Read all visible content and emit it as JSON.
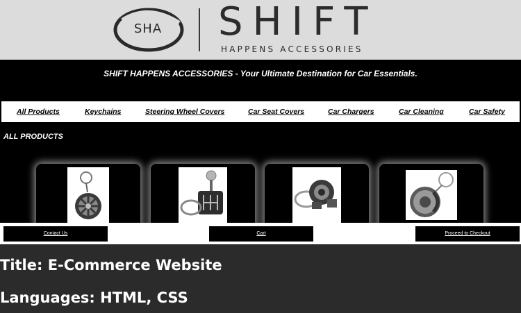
{
  "logo": {
    "initials": "SHA",
    "wordmark": "SHIFT",
    "tagline": "HAPPENS ACCESSORIES"
  },
  "banner": "SHIFT HAPPENS ACCESSORIES - Your Ultimate Destination for Car Essentials.",
  "nav": {
    "items": [
      {
        "label": "All Products"
      },
      {
        "label": "Keychains"
      },
      {
        "label": "Steering Wheel Covers"
      },
      {
        "label": "Car Seat Covers"
      },
      {
        "label": "Car Chargers"
      },
      {
        "label": "Car Cleaning"
      },
      {
        "label": "Car Safety"
      }
    ]
  },
  "section_title": "ALL PRODUCTS",
  "products": [
    {
      "icon": "wheel-rim-keychain-icon"
    },
    {
      "icon": "gear-shifter-keychain-icon"
    },
    {
      "icon": "turbo-keychain-icon"
    },
    {
      "icon": "brake-disc-keychain-icon"
    }
  ],
  "footer": {
    "contact_label": "Contact Us",
    "cart_label": "Cart",
    "checkout_label": "Proceed to Checkout"
  },
  "caption": {
    "title": "Title: E-Commerce Website",
    "languages": "Languages: HTML, CSS"
  },
  "colors": {
    "page_bg": "#000000",
    "logo_bg": "#dcdcdc",
    "caption_bg": "#2b2b2b"
  }
}
